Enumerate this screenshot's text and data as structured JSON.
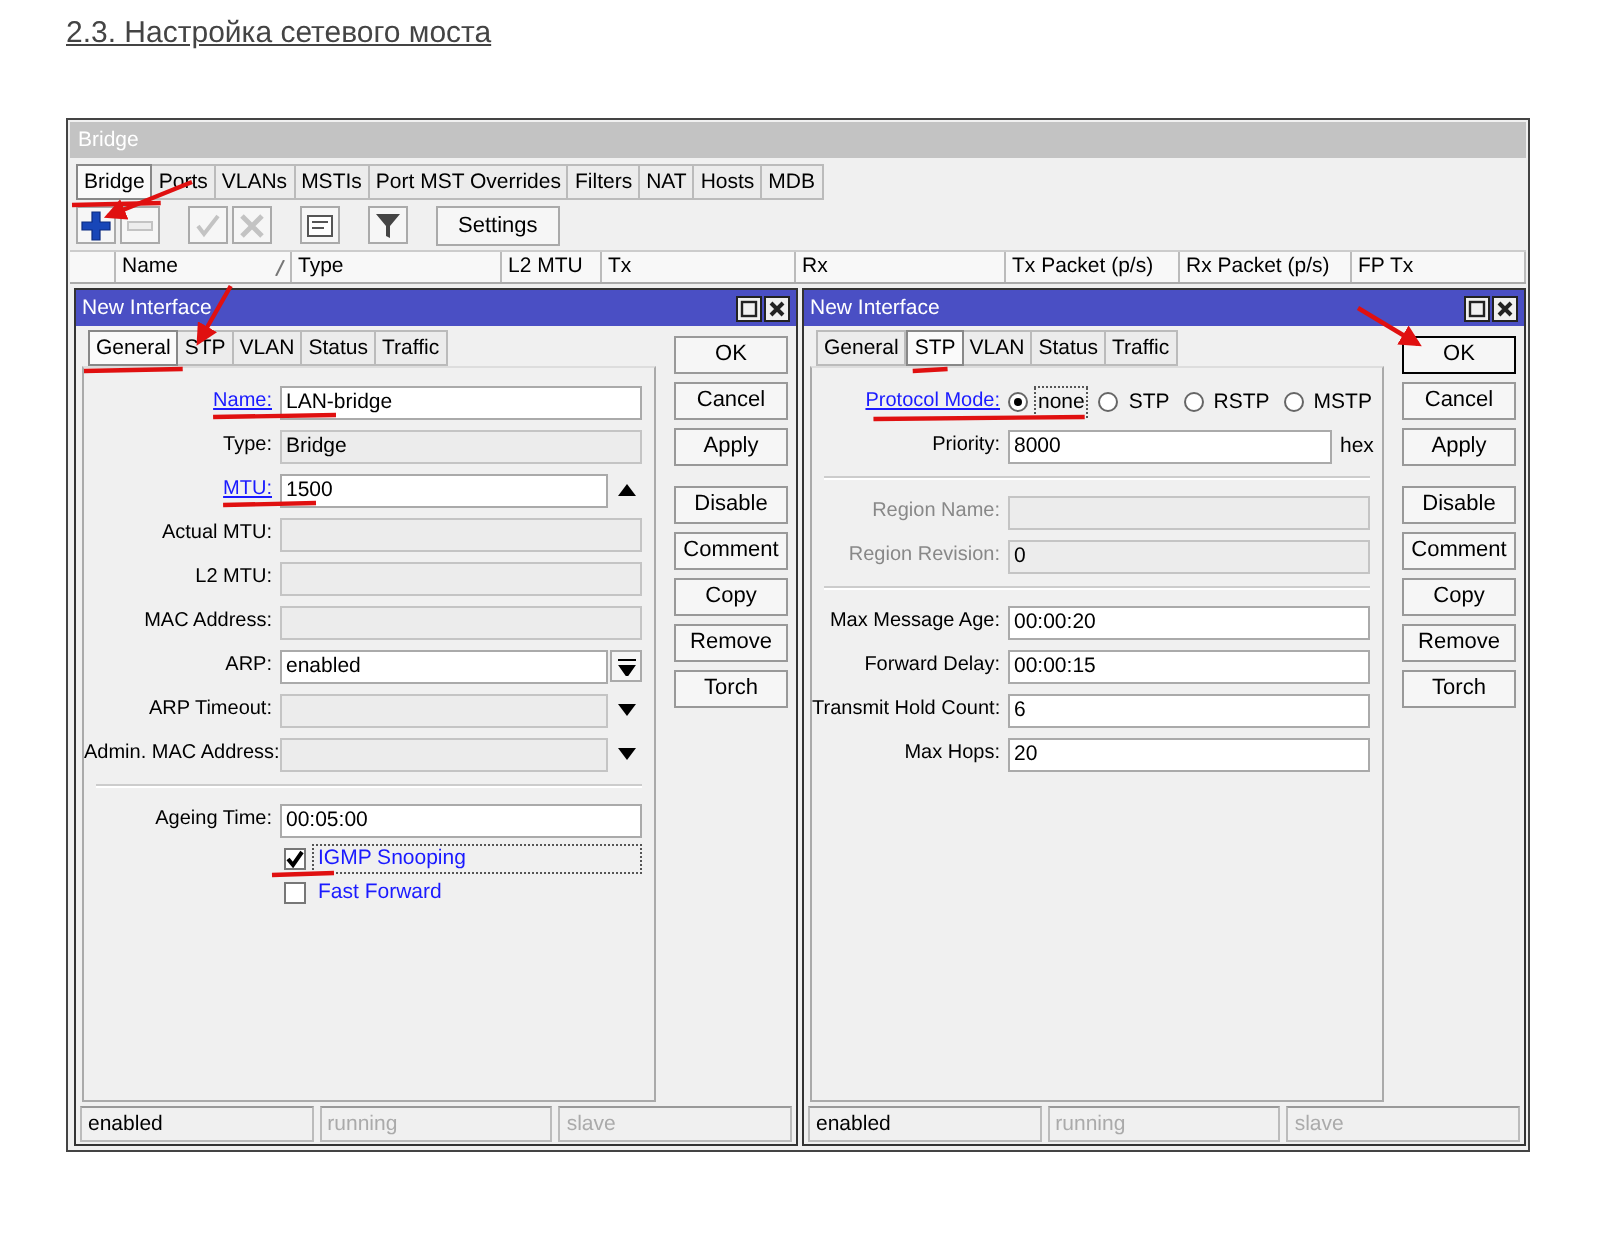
{
  "heading": "2.3. Настройка сетевого моста",
  "window": {
    "title": "Bridge",
    "tabs": [
      {
        "label": "Bridge",
        "selected": true
      },
      {
        "label": "Ports",
        "selected": false
      },
      {
        "label": "VLANs",
        "selected": false
      },
      {
        "label": "MSTIs",
        "selected": false
      },
      {
        "label": "Port MST Overrides",
        "selected": false
      },
      {
        "label": "Filters",
        "selected": false
      },
      {
        "label": "NAT",
        "selected": false
      },
      {
        "label": "Hosts",
        "selected": false
      },
      {
        "label": "MDB",
        "selected": false
      }
    ],
    "toolbar": [
      {
        "kind": "add",
        "disabled": false
      },
      {
        "kind": "remove",
        "disabled": true
      },
      {
        "kind": "separator"
      },
      {
        "kind": "enable",
        "disabled": true
      },
      {
        "kind": "disable",
        "disabled": true
      },
      {
        "kind": "separator"
      },
      {
        "kind": "comment",
        "disabled": false
      },
      {
        "kind": "separator"
      },
      {
        "kind": "filter",
        "disabled": false
      },
      {
        "kind": "separator"
      },
      {
        "kind": "text",
        "label": "Settings"
      }
    ],
    "columns": [
      {
        "label": "Name",
        "sorted": true
      },
      {
        "label": "Type",
        "sorted": false
      },
      {
        "label": "L2 MTU",
        "sorted": false
      },
      {
        "label": "Tx",
        "sorted": false
      },
      {
        "label": "Rx",
        "sorted": false
      },
      {
        "label": "Tx Packet (p/s)",
        "sorted": false
      },
      {
        "label": "Rx Packet (p/s)",
        "sorted": false
      },
      {
        "label": "FP Tx",
        "sorted": false
      }
    ]
  },
  "dialogs": [
    {
      "title": "New Interface",
      "tabs": [
        {
          "label": "General",
          "selected": true
        },
        {
          "label": "STP",
          "selected": false
        },
        {
          "label": "VLAN",
          "selected": false
        },
        {
          "label": "Status",
          "selected": false
        },
        {
          "label": "Traffic",
          "selected": false
        }
      ],
      "fields": [
        {
          "kind": "text",
          "label": "Name:",
          "value": "LAN-bridge",
          "link": true,
          "readonly": false
        },
        {
          "kind": "text",
          "label": "Type:",
          "value": "Bridge",
          "link": false,
          "readonly": true
        },
        {
          "kind": "text",
          "label": "MTU:",
          "value": "1500",
          "link": true,
          "readonly": false,
          "spin": true
        },
        {
          "kind": "text",
          "label": "Actual MTU:",
          "link": false,
          "readonly": true
        },
        {
          "kind": "text",
          "label": "L2 MTU:",
          "link": false,
          "readonly": true
        },
        {
          "kind": "text",
          "label": "MAC Address:",
          "link": false,
          "readonly": true
        },
        {
          "kind": "text",
          "label": "ARP:",
          "value": "enabled",
          "link": false,
          "readonly": false,
          "dropdown": true,
          "boxed": true
        },
        {
          "kind": "text",
          "label": "ARP Timeout:",
          "link": false,
          "readonly": true,
          "dropdown": true,
          "boxed": false
        },
        {
          "kind": "text",
          "label": "Admin. MAC Address:",
          "link": false,
          "readonly": true,
          "dropdown": true,
          "boxed": false
        },
        {
          "kind": "divider"
        },
        {
          "kind": "text",
          "label": "Ageing Time:",
          "value": "00:05:00",
          "link": false,
          "readonly": false
        },
        {
          "kind": "checkbox",
          "label": "IGMP Snooping",
          "checked": true,
          "focused": true
        },
        {
          "kind": "checkbox",
          "label": "Fast Forward",
          "checked": false,
          "focused": false
        }
      ],
      "buttons": [
        {
          "kind": "button",
          "label": "OK",
          "default": false
        },
        {
          "kind": "button",
          "label": "Cancel",
          "default": false
        },
        {
          "kind": "button",
          "label": "Apply",
          "default": false
        },
        {
          "kind": "separator"
        },
        {
          "kind": "button",
          "label": "Disable",
          "default": false
        },
        {
          "kind": "button",
          "label": "Comment",
          "default": false
        },
        {
          "kind": "button",
          "label": "Copy",
          "default": false
        },
        {
          "kind": "button",
          "label": "Remove",
          "default": false
        },
        {
          "kind": "button",
          "label": "Torch",
          "default": false
        }
      ],
      "status": [
        {
          "text": "enabled",
          "disabled": false
        },
        {
          "text": "running",
          "disabled": true
        },
        {
          "text": "slave",
          "disabled": true
        }
      ]
    },
    {
      "title": "New Interface",
      "tabs": [
        {
          "label": "General",
          "selected": false
        },
        {
          "label": "STP",
          "selected": true
        },
        {
          "label": "VLAN",
          "selected": false
        },
        {
          "label": "Status",
          "selected": false
        },
        {
          "label": "Traffic",
          "selected": false
        }
      ],
      "fields": [
        {
          "kind": "radio",
          "label": "Protocol Mode:",
          "link": true,
          "options": [
            {
              "label": "none",
              "selected": true,
              "focused": true
            },
            {
              "label": "STP",
              "selected": false,
              "focused": false
            },
            {
              "label": "RSTP",
              "selected": false,
              "focused": false
            },
            {
              "label": "MSTP",
              "selected": false,
              "focused": false
            }
          ]
        },
        {
          "kind": "text",
          "label": "Priority:",
          "value": "8000",
          "link": false,
          "readonly": false,
          "unit": "hex"
        },
        {
          "kind": "divider"
        },
        {
          "kind": "text",
          "label": "Region Name:",
          "link": false,
          "readonly": true,
          "disabled": true
        },
        {
          "kind": "text",
          "label": "Region Revision:",
          "value": "0",
          "link": false,
          "readonly": true,
          "disabled": true
        },
        {
          "kind": "divider"
        },
        {
          "kind": "text",
          "label": "Max Message Age:",
          "value": "00:00:20",
          "link": false,
          "readonly": false
        },
        {
          "kind": "text",
          "label": "Forward Delay:",
          "value": "00:00:15",
          "link": false,
          "readonly": false
        },
        {
          "kind": "text",
          "label": "Transmit Hold Count:",
          "value": "6",
          "link": false,
          "readonly": false
        },
        {
          "kind": "text",
          "label": "Max Hops:",
          "value": "20",
          "link": false,
          "readonly": false
        }
      ],
      "buttons": [
        {
          "kind": "button",
          "label": "OK",
          "default": true
        },
        {
          "kind": "button",
          "label": "Cancel",
          "default": false
        },
        {
          "kind": "button",
          "label": "Apply",
          "default": false
        },
        {
          "kind": "separator"
        },
        {
          "kind": "button",
          "label": "Disable",
          "default": false
        },
        {
          "kind": "button",
          "label": "Comment",
          "default": false
        },
        {
          "kind": "button",
          "label": "Copy",
          "default": false
        },
        {
          "kind": "button",
          "label": "Remove",
          "default": false
        },
        {
          "kind": "button",
          "label": "Torch",
          "default": false
        }
      ],
      "status": [
        {
          "text": "enabled",
          "disabled": false
        },
        {
          "text": "running",
          "disabled": true
        },
        {
          "text": "slave",
          "disabled": true
        }
      ]
    }
  ]
}
